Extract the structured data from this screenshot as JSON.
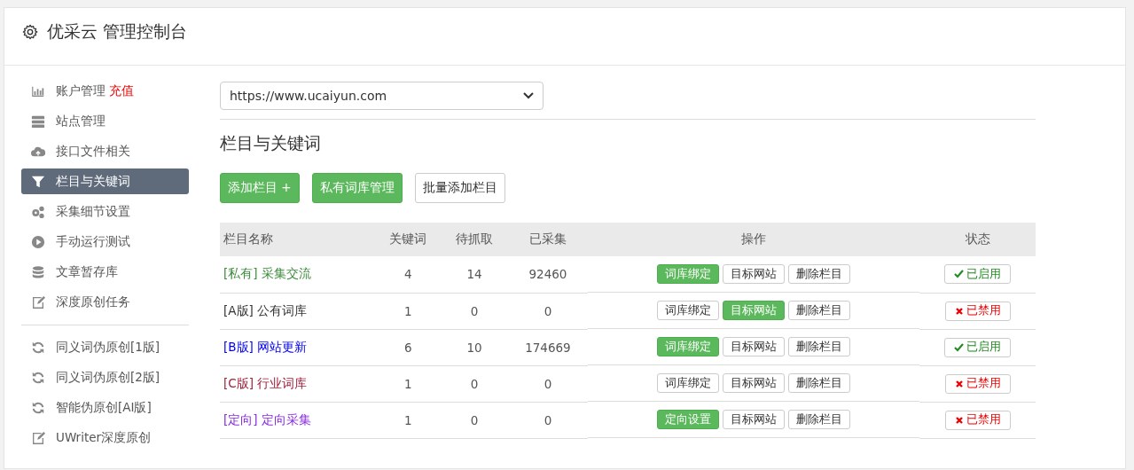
{
  "header": {
    "title": "优采云 管理控制台"
  },
  "sidebar": {
    "groups": [
      [
        {
          "label": "账户管理",
          "badge": "充值",
          "selected": false
        },
        {
          "label": "站点管理",
          "selected": false
        },
        {
          "label": "接口文件相关",
          "selected": false
        },
        {
          "label": "栏目与关键词",
          "selected": true
        },
        {
          "label": "采集细节设置",
          "selected": false
        },
        {
          "label": "手动运行测试",
          "selected": false
        },
        {
          "label": "文章暂存库",
          "selected": false
        },
        {
          "label": "深度原创任务",
          "selected": false
        }
      ],
      [
        {
          "label": "同义词伪原创[1版]",
          "selected": false
        },
        {
          "label": "同义词伪原创[2版]",
          "selected": false
        },
        {
          "label": "智能伪原创[AI版]",
          "selected": false
        },
        {
          "label": "UWriter深度原创",
          "selected": false
        }
      ]
    ]
  },
  "site_select": {
    "value": "https://www.ucaiyun.com"
  },
  "section_title": "栏目与关键词",
  "toolbar": [
    {
      "label": "添加栏目 +",
      "kind": "success"
    },
    {
      "label": "私有词库管理",
      "kind": "success"
    },
    {
      "label": "批量添加栏目",
      "kind": "default"
    }
  ],
  "table": {
    "columns": [
      "栏目名称",
      "关键词",
      "待抓取",
      "已采集",
      "操作",
      "状态"
    ],
    "rows": [
      {
        "color": "#3d8b3d",
        "cells": [
          "[私有] 采集交流",
          "4",
          "14",
          "92460"
        ],
        "actions": [
          {
            "label": "词库绑定",
            "primary": true
          },
          {
            "label": "目标网站",
            "primary": false
          },
          {
            "label": "删除栏目",
            "primary": false
          }
        ],
        "status": {
          "label": "已启用",
          "on": true
        }
      },
      {
        "color": "#333333",
        "cells": [
          "[A版] 公有词库",
          "1",
          "0",
          "0"
        ],
        "actions": [
          {
            "label": "词库绑定",
            "primary": false
          },
          {
            "label": "目标网站",
            "primary": true
          },
          {
            "label": "删除栏目",
            "primary": false
          }
        ],
        "status": {
          "label": "已禁用",
          "on": false
        }
      },
      {
        "color": "#0000ee",
        "cells": [
          "[B版] 网站更新",
          "6",
          "10",
          "174669"
        ],
        "actions": [
          {
            "label": "词库绑定",
            "primary": true
          },
          {
            "label": "目标网站",
            "primary": false
          },
          {
            "label": "删除栏目",
            "primary": false
          }
        ],
        "status": {
          "label": "已启用",
          "on": true
        }
      },
      {
        "color": "#a0203a",
        "cells": [
          "[C版] 行业词库",
          "1",
          "0",
          "0"
        ],
        "actions": [
          {
            "label": "词库绑定",
            "primary": false
          },
          {
            "label": "目标网站",
            "primary": false
          },
          {
            "label": "删除栏目",
            "primary": false
          }
        ],
        "status": {
          "label": "已禁用",
          "on": false
        }
      },
      {
        "color": "#8a2be2",
        "cells": [
          "[定向] 定向采集",
          "1",
          "0",
          "0"
        ],
        "actions": [
          {
            "label": "定向设置",
            "primary": true
          },
          {
            "label": "目标网站",
            "primary": false
          },
          {
            "label": "删除栏目",
            "primary": false
          }
        ],
        "status": {
          "label": "已禁用",
          "on": false
        }
      }
    ]
  }
}
